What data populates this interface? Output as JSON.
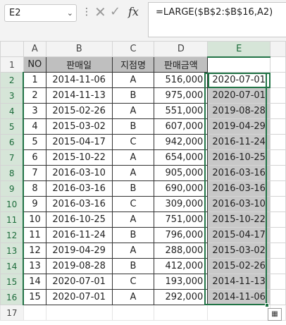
{
  "name_box": "E2",
  "formula": "=LARGE($B$2:$B$16,A2)",
  "icons": {
    "cancel": "cancel-x-icon",
    "enter": "check-icon",
    "fx": "fx"
  },
  "fx_label": "fx",
  "columns": [
    "A",
    "B",
    "C",
    "D",
    "E"
  ],
  "selected_column": "E",
  "header_row": {
    "row": "1",
    "cells": [
      "NO",
      "판매일",
      "지점명",
      "판매금액",
      ""
    ]
  },
  "rows": [
    {
      "row": "2",
      "no": "1",
      "date": "2014-11-06",
      "branch": "A",
      "amount": "516,000",
      "large": "2020-07-01"
    },
    {
      "row": "3",
      "no": "2",
      "date": "2014-11-13",
      "branch": "B",
      "amount": "975,000",
      "large": "2020-07-01"
    },
    {
      "row": "4",
      "no": "3",
      "date": "2015-02-26",
      "branch": "A",
      "amount": "551,000",
      "large": "2019-08-28"
    },
    {
      "row": "5",
      "no": "4",
      "date": "2015-03-02",
      "branch": "B",
      "amount": "607,000",
      "large": "2019-04-29"
    },
    {
      "row": "6",
      "no": "5",
      "date": "2015-04-17",
      "branch": "C",
      "amount": "942,000",
      "large": "2016-11-24"
    },
    {
      "row": "7",
      "no": "6",
      "date": "2015-10-22",
      "branch": "A",
      "amount": "654,000",
      "large": "2016-10-25"
    },
    {
      "row": "8",
      "no": "7",
      "date": "2016-03-10",
      "branch": "A",
      "amount": "905,000",
      "large": "2016-03-16"
    },
    {
      "row": "9",
      "no": "8",
      "date": "2016-03-16",
      "branch": "B",
      "amount": "690,000",
      "large": "2016-03-16"
    },
    {
      "row": "10",
      "no": "9",
      "date": "2016-03-16",
      "branch": "C",
      "amount": "309,000",
      "large": "2016-03-10"
    },
    {
      "row": "11",
      "no": "10",
      "date": "2016-10-25",
      "branch": "A",
      "amount": "751,000",
      "large": "2015-10-22"
    },
    {
      "row": "12",
      "no": "11",
      "date": "2016-11-24",
      "branch": "B",
      "amount": "796,000",
      "large": "2015-04-17"
    },
    {
      "row": "13",
      "no": "12",
      "date": "2019-04-29",
      "branch": "A",
      "amount": "288,000",
      "large": "2015-03-02"
    },
    {
      "row": "14",
      "no": "13",
      "date": "2019-08-28",
      "branch": "B",
      "amount": "412,000",
      "large": "2015-02-26"
    },
    {
      "row": "15",
      "no": "14",
      "date": "2020-07-01",
      "branch": "C",
      "amount": "193,000",
      "large": "2014-11-13"
    },
    {
      "row": "16",
      "no": "15",
      "date": "2020-07-01",
      "branch": "A",
      "amount": "292,000",
      "large": "2014-11-06"
    }
  ],
  "trailing_row": "17"
}
